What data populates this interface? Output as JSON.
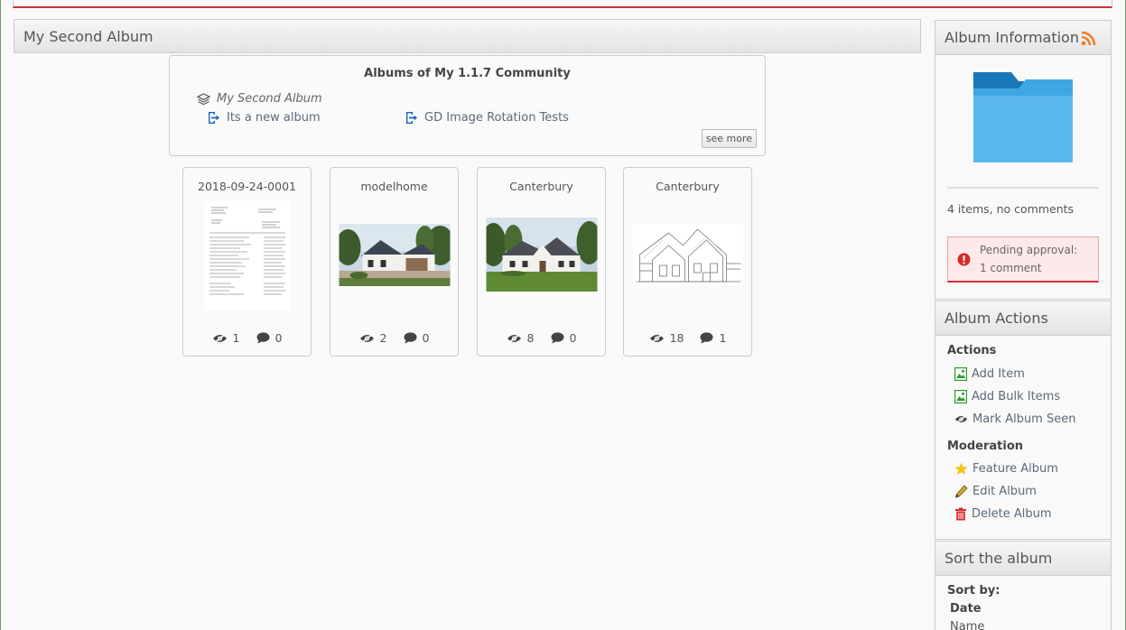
{
  "main": {
    "title": "My Second Album",
    "albums_box": {
      "title": "Albums of My 1.1.7 Community",
      "current": "My Second Album",
      "links": [
        "Its a new album",
        "GD Image Rotation Tests"
      ],
      "see_more": "see more"
    },
    "items": [
      {
        "title": "2018-09-24-0001",
        "views": "1",
        "comments": "0",
        "kind": "document"
      },
      {
        "title": "modelhome",
        "views": "2",
        "comments": "0",
        "kind": "house-photo"
      },
      {
        "title": "Canterbury",
        "views": "8",
        "comments": "0",
        "kind": "house-photo"
      },
      {
        "title": "Canterbury",
        "views": "18",
        "comments": "1",
        "kind": "house-drawing"
      }
    ]
  },
  "sidebar": {
    "info": {
      "title": "Album Information",
      "summary": "4 items, no comments",
      "pending_line1": "Pending approval:",
      "pending_line2": "1 comment"
    },
    "actions": {
      "title": "Album Actions",
      "group_actions": "Actions",
      "add_item": "Add Item",
      "add_bulk": "Add Bulk Items",
      "mark_seen": "Mark Album Seen",
      "group_moderation": "Moderation",
      "feature": "Feature Album",
      "edit": "Edit Album",
      "delete": "Delete Album"
    },
    "sort": {
      "title": "Sort the album",
      "label": "Sort by:",
      "option_date": "Date",
      "option_name": "Name"
    }
  },
  "colors": {
    "accent_red": "#cc3333",
    "rss_orange": "#f27a1a",
    "folder_blue": "#3ea6e3",
    "link_blue": "#1a63b8"
  }
}
